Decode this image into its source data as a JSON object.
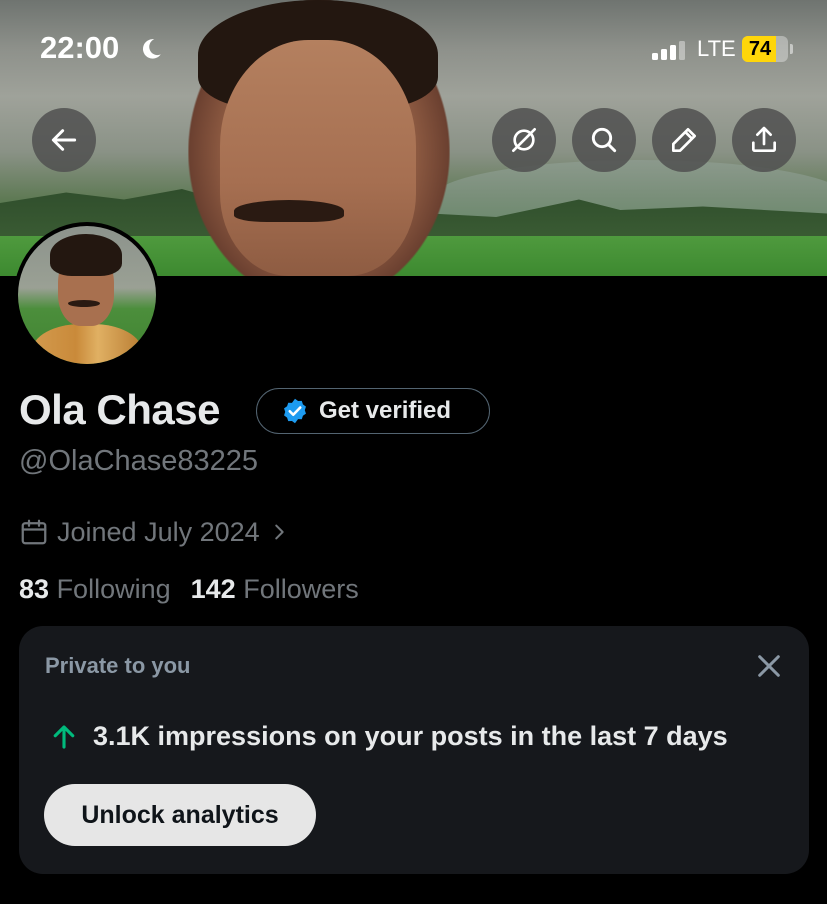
{
  "status_bar": {
    "time": "22:00",
    "network": "LTE",
    "battery": "74",
    "battery_level": 0.74,
    "icons": [
      "moon-icon",
      "signal-icon"
    ]
  },
  "header": {
    "buttons": [
      "back-arrow-icon",
      "grok-icon",
      "search-icon",
      "edit-pencil-icon",
      "share-icon"
    ]
  },
  "profile": {
    "name": "Ola Chase",
    "verify_label": "Get verified",
    "handle": "@OlaChase83225",
    "joined": "Joined July 2024",
    "following_count": "83",
    "following_label": "Following",
    "followers_count": "142",
    "followers_label": "Followers"
  },
  "analytics_card": {
    "title": "Private to you",
    "stat": "3.1K impressions on your posts in the last 7 days",
    "button": "Unlock analytics",
    "accent_color": "#00ba7c"
  },
  "colors": {
    "background": "#000000",
    "verified_blue": "#1d9bf0",
    "battery": "#ffd60a"
  }
}
